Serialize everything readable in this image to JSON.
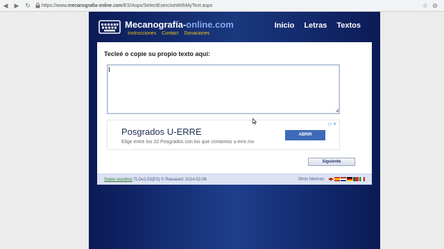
{
  "browser": {
    "url_prefix": "https://www.",
    "url_host": "mecanografia-online.com",
    "url_path": "/ES/Aspx/SelectExerciseWithMyText.aspx"
  },
  "site": {
    "brand_main": "Mecanografía-",
    "brand_highlight": "online.com",
    "sublinks": [
      "Instrucciones",
      "Contact",
      "Donaciones"
    ],
    "nav": [
      "Inicio",
      "Letras",
      "Textos"
    ]
  },
  "main": {
    "prompt": "Tecleé o copie su propio texto aquí:",
    "text_value": ""
  },
  "ad": {
    "title": "Posgrados U-ERRE",
    "text": "Elige entre los 32 Posgrados con los que contamos u-erre.mx",
    "button": "ABRIR"
  },
  "actions": {
    "next_label": "Siguiente"
  },
  "footer": {
    "about": "Sobre nosotros",
    "version": " TLOv2.03(ES) © Released: 2014-02-06",
    "other_languages": "Otros Idiomas:"
  },
  "colors": {
    "site_dark": "#0a1a55",
    "site_light": "#1e3e8c",
    "accent_yellow": "#f0c419",
    "brand_highlight": "#86aaf0"
  },
  "icons": [
    "back-icon",
    "forward-icon",
    "reload-icon",
    "lock-icon",
    "star-icon",
    "block-icon",
    "keyboard-logo-icon",
    "adchoices-icon",
    "close-icon",
    "cursor-icon"
  ]
}
